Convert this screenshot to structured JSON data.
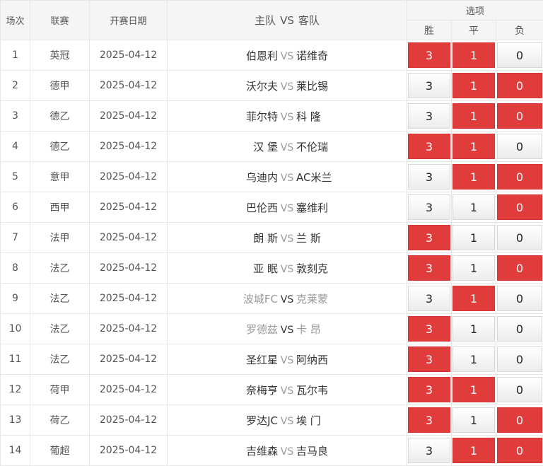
{
  "header": {
    "no": "场次",
    "league": "联赛",
    "date": "开赛日期",
    "home": "主队",
    "vs": "VS",
    "away": "客队",
    "options": "选项",
    "win": "胜",
    "draw": "平",
    "loss": "负"
  },
  "colors": {
    "selected": "#e03c3c",
    "normal": "#f3f3f3"
  },
  "rows": [
    {
      "no": "1",
      "league": "英冠",
      "date": "2025-04-12",
      "home": "伯恩利",
      "vs": "VS",
      "away": "诺维奇",
      "faded": false,
      "opts": [
        {
          "v": "3",
          "on": true
        },
        {
          "v": "1",
          "on": true
        },
        {
          "v": "0",
          "on": false
        }
      ]
    },
    {
      "no": "2",
      "league": "德甲",
      "date": "2025-04-12",
      "home": "沃尔夫",
      "vs": "VS",
      "away": "莱比锡",
      "faded": false,
      "opts": [
        {
          "v": "3",
          "on": false
        },
        {
          "v": "1",
          "on": true
        },
        {
          "v": "0",
          "on": true
        }
      ]
    },
    {
      "no": "3",
      "league": "德乙",
      "date": "2025-04-12",
      "home": "菲尔特",
      "vs": "VS",
      "away": "科 隆",
      "faded": false,
      "opts": [
        {
          "v": "3",
          "on": false
        },
        {
          "v": "1",
          "on": true
        },
        {
          "v": "0",
          "on": true
        }
      ]
    },
    {
      "no": "4",
      "league": "德乙",
      "date": "2025-04-12",
      "home": "汉 堡",
      "vs": "VS",
      "away": "不伦瑞",
      "faded": false,
      "opts": [
        {
          "v": "3",
          "on": true
        },
        {
          "v": "1",
          "on": true
        },
        {
          "v": "0",
          "on": false
        }
      ]
    },
    {
      "no": "5",
      "league": "意甲",
      "date": "2025-04-12",
      "home": "乌迪内",
      "vs": "VS",
      "away": "AC米兰",
      "faded": false,
      "opts": [
        {
          "v": "3",
          "on": false
        },
        {
          "v": "1",
          "on": true
        },
        {
          "v": "0",
          "on": true
        }
      ]
    },
    {
      "no": "6",
      "league": "西甲",
      "date": "2025-04-12",
      "home": "巴伦西",
      "vs": "VS",
      "away": "塞维利",
      "faded": false,
      "opts": [
        {
          "v": "3",
          "on": false
        },
        {
          "v": "1",
          "on": false
        },
        {
          "v": "0",
          "on": true
        }
      ]
    },
    {
      "no": "7",
      "league": "法甲",
      "date": "2025-04-12",
      "home": "朗 斯",
      "vs": "VS",
      "away": "兰 斯",
      "faded": false,
      "opts": [
        {
          "v": "3",
          "on": true
        },
        {
          "v": "1",
          "on": false
        },
        {
          "v": "0",
          "on": false
        }
      ]
    },
    {
      "no": "8",
      "league": "法乙",
      "date": "2025-04-12",
      "home": "亚 眠",
      "vs": "VS",
      "away": "敦刻克",
      "faded": false,
      "opts": [
        {
          "v": "3",
          "on": true
        },
        {
          "v": "1",
          "on": false
        },
        {
          "v": "0",
          "on": true
        }
      ]
    },
    {
      "no": "9",
      "league": "法乙",
      "date": "2025-04-12",
      "home": "波城FC",
      "vs": "VS",
      "away": "克莱蒙",
      "faded": true,
      "opts": [
        {
          "v": "3",
          "on": false
        },
        {
          "v": "1",
          "on": true
        },
        {
          "v": "0",
          "on": false
        }
      ]
    },
    {
      "no": "10",
      "league": "法乙",
      "date": "2025-04-12",
      "home": "罗德兹",
      "vs": "VS",
      "away": "卡 昂",
      "faded": true,
      "opts": [
        {
          "v": "3",
          "on": true
        },
        {
          "v": "1",
          "on": false
        },
        {
          "v": "0",
          "on": false
        }
      ]
    },
    {
      "no": "11",
      "league": "法乙",
      "date": "2025-04-12",
      "home": "圣红星",
      "vs": "VS",
      "away": "阿纳西",
      "faded": false,
      "opts": [
        {
          "v": "3",
          "on": true
        },
        {
          "v": "1",
          "on": false
        },
        {
          "v": "0",
          "on": false
        }
      ]
    },
    {
      "no": "12",
      "league": "荷甲",
      "date": "2025-04-12",
      "home": "奈梅亨",
      "vs": "VS",
      "away": "瓦尔韦",
      "faded": false,
      "opts": [
        {
          "v": "3",
          "on": true
        },
        {
          "v": "1",
          "on": true
        },
        {
          "v": "0",
          "on": false
        }
      ]
    },
    {
      "no": "13",
      "league": "荷乙",
      "date": "2025-04-12",
      "home": "罗达JC",
      "vs": "VS",
      "away": "埃 门",
      "faded": false,
      "opts": [
        {
          "v": "3",
          "on": true
        },
        {
          "v": "1",
          "on": false
        },
        {
          "v": "0",
          "on": true
        }
      ]
    },
    {
      "no": "14",
      "league": "葡超",
      "date": "2025-04-12",
      "home": "吉维森",
      "vs": "VS",
      "away": "吉马良",
      "faded": false,
      "opts": [
        {
          "v": "3",
          "on": false
        },
        {
          "v": "1",
          "on": true
        },
        {
          "v": "0",
          "on": true
        }
      ]
    }
  ]
}
